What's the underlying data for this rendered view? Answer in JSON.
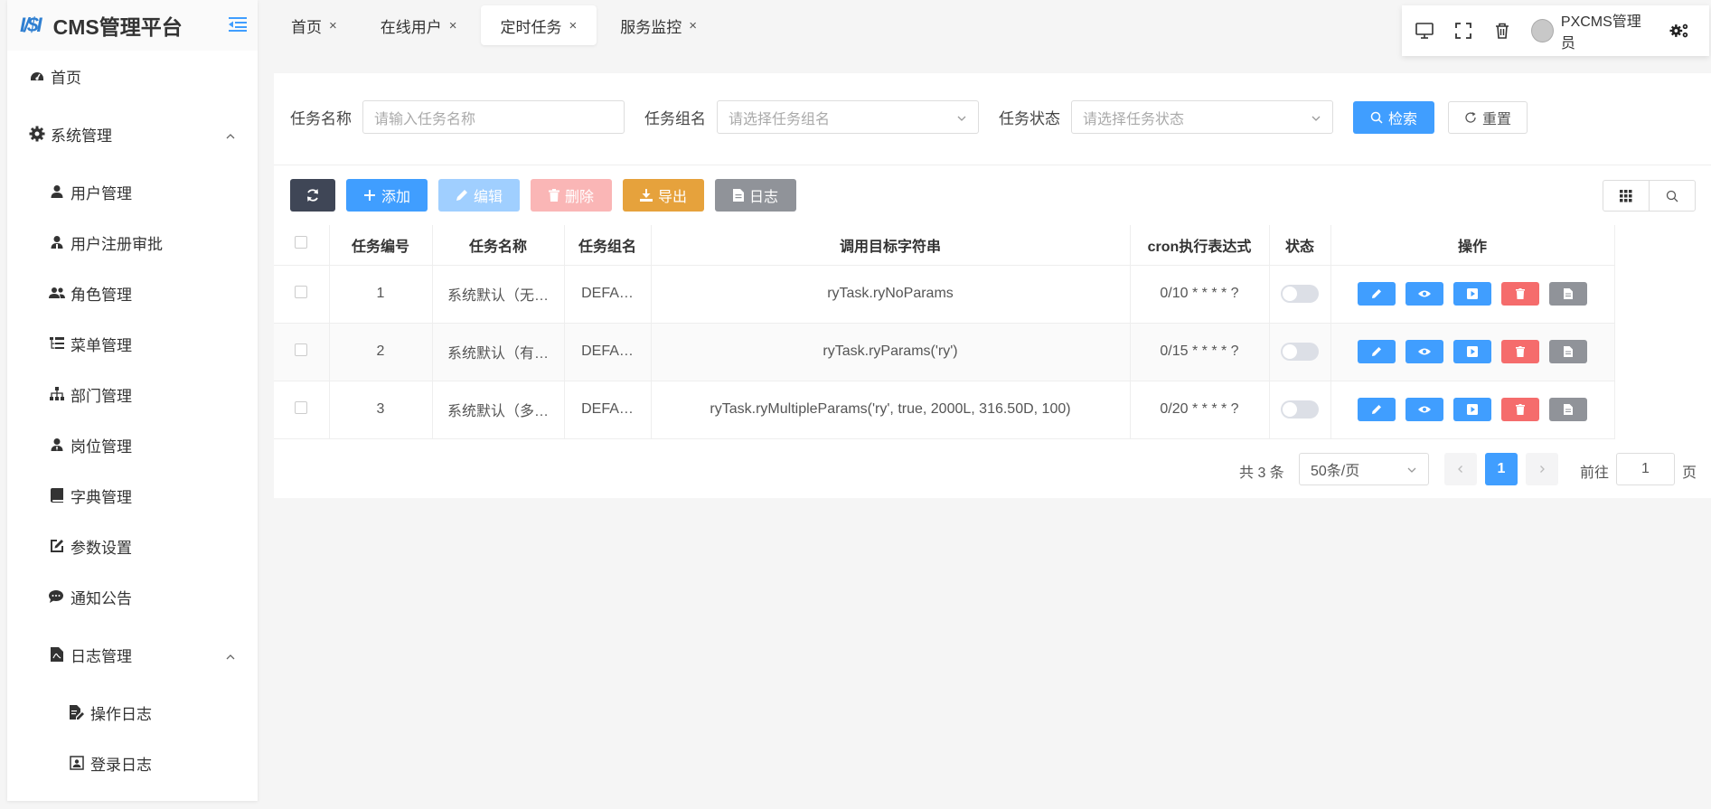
{
  "app": {
    "logo_mark": "I/$I",
    "title": "CMS管理平台"
  },
  "sidebar": {
    "items": [
      {
        "label": "首页"
      },
      {
        "label": "系统管理"
      },
      {
        "label": "用户管理"
      },
      {
        "label": "用户注册审批"
      },
      {
        "label": "角色管理"
      },
      {
        "label": "菜单管理"
      },
      {
        "label": "部门管理"
      },
      {
        "label": "岗位管理"
      },
      {
        "label": "字典管理"
      },
      {
        "label": "参数设置"
      },
      {
        "label": "通知公告"
      },
      {
        "label": "日志管理"
      },
      {
        "label": "操作日志"
      },
      {
        "label": "登录日志"
      }
    ]
  },
  "tabs": [
    {
      "label": "首页",
      "close": "×"
    },
    {
      "label": "在线用户",
      "close": "×"
    },
    {
      "label": "定时任务",
      "close": "×"
    },
    {
      "label": "服务监控",
      "close": "×"
    }
  ],
  "header": {
    "username": "PXCMS管理员"
  },
  "search": {
    "name_label": "任务名称",
    "name_placeholder": "请输入任务名称",
    "group_label": "任务组名",
    "group_placeholder": "请选择任务组名",
    "status_label": "任务状态",
    "status_placeholder": "请选择任务状态",
    "search_btn": "检索",
    "reset_btn": "重置"
  },
  "toolbar": {
    "add": "添加",
    "edit": "编辑",
    "delete": "删除",
    "export": "导出",
    "log": "日志"
  },
  "table": {
    "headers": [
      "任务编号",
      "任务名称",
      "任务组名",
      "调用目标字符串",
      "cron执行表达式",
      "状态",
      "操作"
    ],
    "rows": [
      {
        "id": "1",
        "name": "系统默认（无…",
        "group": "DEFA…",
        "target": "ryTask.ryNoParams",
        "cron": "0/10 * * * * ?"
      },
      {
        "id": "2",
        "name": "系统默认（有…",
        "group": "DEFA…",
        "target": "ryTask.ryParams('ry')",
        "cron": "0/15 * * * * ?"
      },
      {
        "id": "3",
        "name": "系统默认（多…",
        "group": "DEFA…",
        "target": "ryTask.ryMultipleParams('ry', true, 2000L, 316.50D, 100)",
        "cron": "0/20 * * * * ?"
      }
    ]
  },
  "pagination": {
    "total": "共 3 条",
    "page_size": "50条/页",
    "current": "1",
    "goto_label": "前往",
    "goto_value": "1",
    "page_label": "页"
  },
  "colors": {
    "primary": "#409eff",
    "edit_disabled": "#a0cfff",
    "delete_disabled": "#fab6b6",
    "warning": "#e6a23c",
    "info": "#909399",
    "dark": "#3f4656",
    "danger": "#f56c6c"
  }
}
